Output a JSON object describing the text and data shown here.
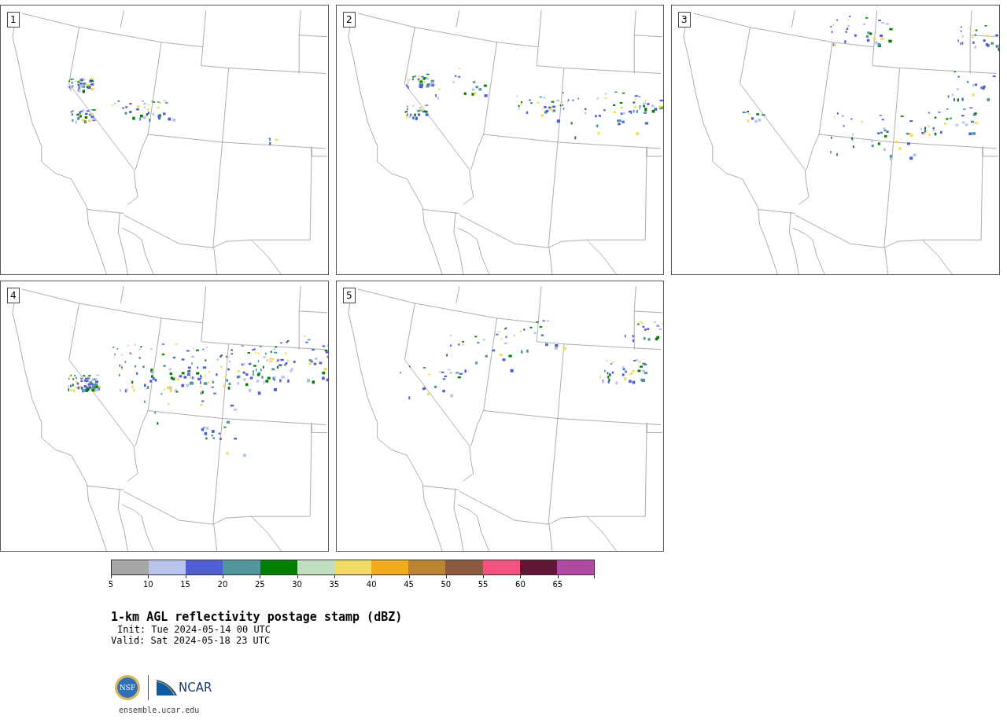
{
  "panels": [
    {
      "number": "1"
    },
    {
      "number": "2"
    },
    {
      "number": "3"
    },
    {
      "number": "4"
    },
    {
      "number": "5"
    }
  ],
  "colorbar": {
    "segments": [
      {
        "color": "#a6a6a6"
      },
      {
        "color": "#b8c4ec"
      },
      {
        "color": "#5060d3"
      },
      {
        "color": "#50969a"
      },
      {
        "color": "#008000"
      },
      {
        "color": "#c0dfc0"
      },
      {
        "color": "#f0dc60"
      },
      {
        "color": "#f0ad18"
      },
      {
        "color": "#bb8430"
      },
      {
        "color": "#8c5a3e"
      },
      {
        "color": "#f55280"
      },
      {
        "color": "#621636"
      },
      {
        "color": "#b04ba2"
      }
    ],
    "ticks": [
      "5",
      "10",
      "15",
      "20",
      "25",
      "30",
      "35",
      "40",
      "45",
      "50",
      "55",
      "60",
      "65"
    ]
  },
  "title": "1-km AGL reflectivity postage stamp (dBZ)",
  "init": "Init: Tue 2024-05-14 00 UTC",
  "valid": "Valid: Sat 2024-05-18 23 UTC",
  "logo": {
    "seal_text": "NSF",
    "wordmark": "NCAR"
  },
  "site": "ensemble.ucar.edu"
}
